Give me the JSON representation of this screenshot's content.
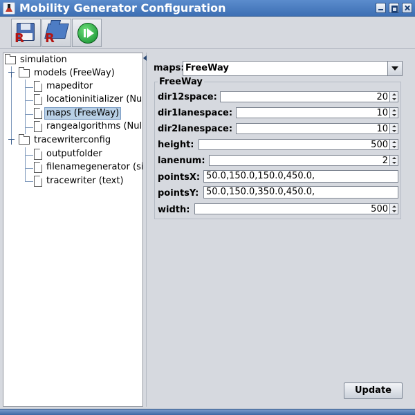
{
  "window": {
    "title": "Mobility Generator Configuration"
  },
  "toolbar": {
    "buttons": [
      {
        "icon": "save-icon",
        "name": "save"
      },
      {
        "icon": "open-folder-icon",
        "name": "open"
      },
      {
        "icon": "play-icon",
        "name": "run"
      }
    ],
    "badge_letter": "R"
  },
  "tree": {
    "root": "simulation",
    "models": "models (FreeWay)",
    "model_children": [
      "mapeditor",
      "locationinitializer (Null",
      "maps (FreeWay)",
      "rangealgorithms (Null"
    ],
    "tracewriter": "tracewriterconfig",
    "tracewriter_children": [
      "outputfolder",
      "filenamegenerator (si",
      "tracewriter (text)"
    ],
    "selected": "maps (FreeWay)"
  },
  "form": {
    "maps_label": "maps:",
    "maps_value": "FreeWay",
    "group_title": "FreeWay",
    "fields": {
      "dir12space": {
        "label": "dir12space:",
        "value": "20"
      },
      "dir1lanespace": {
        "label": "dir1lanespace:",
        "value": "10"
      },
      "dir2lanespace": {
        "label": "dir2lanespace:",
        "value": "10"
      },
      "height": {
        "label": "height:",
        "value": "500"
      },
      "lanenum": {
        "label": "lanenum:",
        "value": "2"
      },
      "pointsX": {
        "label": "pointsX:",
        "value": "50.0,150.0,150.0,450.0,"
      },
      "pointsY": {
        "label": "pointsY:",
        "value": "50.0,150.0,350.0,450.0,"
      },
      "width": {
        "label": "width:",
        "value": "500"
      }
    },
    "update_label": "Update"
  }
}
